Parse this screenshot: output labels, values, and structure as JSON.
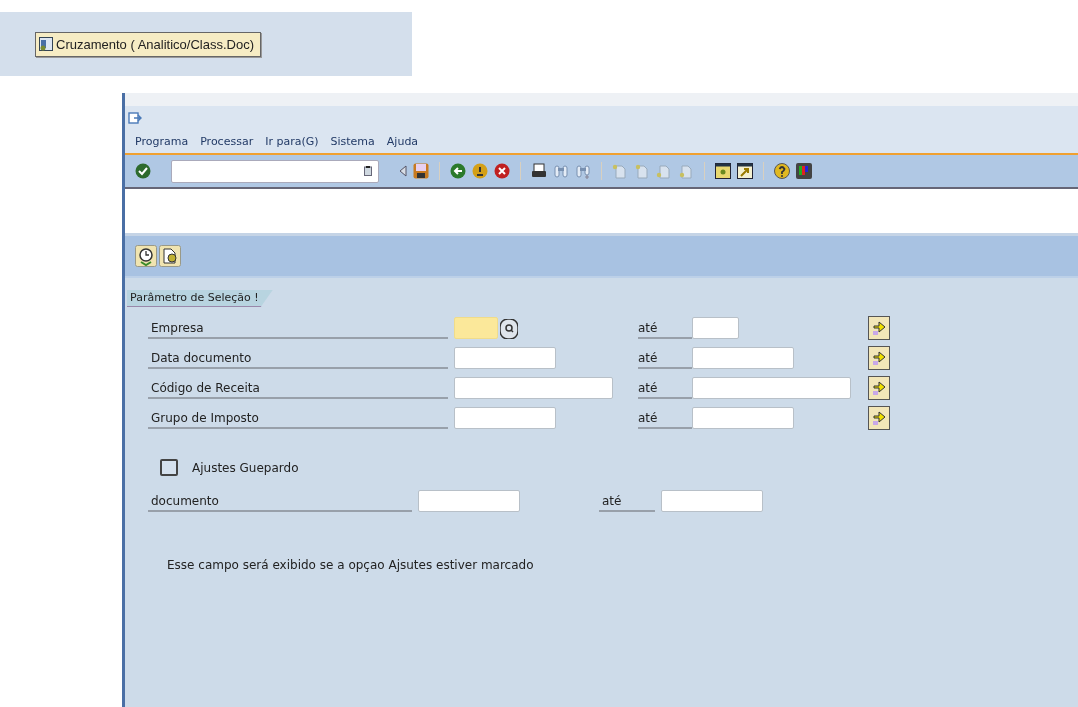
{
  "top_button": {
    "label": "Cruzamento ( Analitico/Class.Doc)"
  },
  "menu": [
    "Programa",
    "Processar",
    "Ir para(G)",
    "Sistema",
    "Ajuda"
  ],
  "selection": {
    "title": "Parâmetro de Seleção !",
    "rows": [
      {
        "label": "Empresa",
        "to_label": "até",
        "required": true,
        "search_help": true
      },
      {
        "label": "Data documento",
        "to_label": "até",
        "required": false,
        "search_help": false
      },
      {
        "label": "Código de Receita",
        "to_label": "até",
        "required": false,
        "search_help": false
      },
      {
        "label": "Grupo de Imposto",
        "to_label": "até",
        "required": false,
        "search_help": false
      }
    ]
  },
  "ajustes": {
    "label": "Ajustes Guepardo",
    "checked": false
  },
  "documento": {
    "label": "documento",
    "to_label": "até"
  },
  "note": "Esse campo será exibido se a opçao Ajsutes estiver marcado"
}
